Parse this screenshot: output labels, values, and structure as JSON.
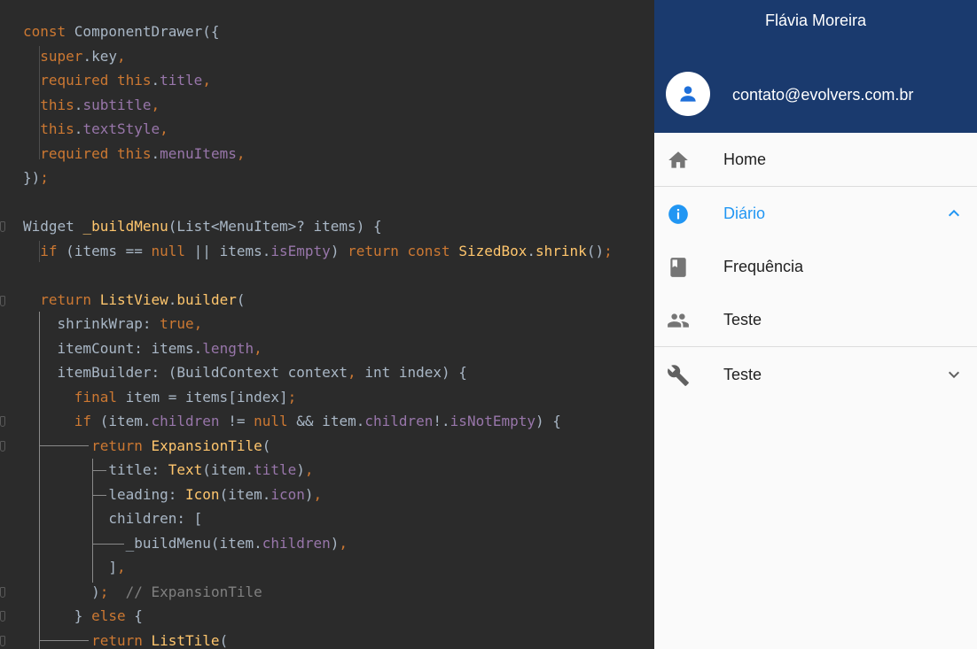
{
  "code": {
    "lines": [
      [
        {
          "t": "const ",
          "c": "kw"
        },
        {
          "t": "ComponentDrawer({",
          "c": ""
        }
      ],
      [
        {
          "t": "  super",
          "c": "kw"
        },
        {
          "t": ".key",
          "c": ""
        },
        {
          "t": ",",
          "c": "kw"
        }
      ],
      [
        {
          "t": "  required this",
          "c": "kw"
        },
        {
          "t": ".",
          "c": ""
        },
        {
          "t": "title",
          "c": "fld"
        },
        {
          "t": ",",
          "c": "kw"
        }
      ],
      [
        {
          "t": "  this",
          "c": "kw"
        },
        {
          "t": ".",
          "c": ""
        },
        {
          "t": "subtitle",
          "c": "fld"
        },
        {
          "t": ",",
          "c": "kw"
        }
      ],
      [
        {
          "t": "  this",
          "c": "kw"
        },
        {
          "t": ".",
          "c": ""
        },
        {
          "t": "textStyle",
          "c": "fld"
        },
        {
          "t": ",",
          "c": "kw"
        }
      ],
      [
        {
          "t": "  required this",
          "c": "kw"
        },
        {
          "t": ".",
          "c": ""
        },
        {
          "t": "menuItems",
          "c": "fld"
        },
        {
          "t": ",",
          "c": "kw"
        }
      ],
      [
        {
          "t": "})",
          "c": ""
        },
        {
          "t": ";",
          "c": "kw"
        }
      ],
      [],
      [
        {
          "t": "Widget ",
          "c": ""
        },
        {
          "t": "_buildMenu",
          "c": "fn"
        },
        {
          "t": "(List<MenuItem>? items) {",
          "c": ""
        }
      ],
      [
        {
          "t": "  if ",
          "c": "kw"
        },
        {
          "t": "(items == ",
          "c": ""
        },
        {
          "t": "null ",
          "c": "kw"
        },
        {
          "t": "|| items.",
          "c": ""
        },
        {
          "t": "isEmpty",
          "c": "fld"
        },
        {
          "t": ") ",
          "c": ""
        },
        {
          "t": "return const ",
          "c": "kw"
        },
        {
          "t": "SizedBox",
          "c": "fn"
        },
        {
          "t": ".",
          "c": ""
        },
        {
          "t": "shrink",
          "c": "fn"
        },
        {
          "t": "()",
          "c": ""
        },
        {
          "t": ";",
          "c": "kw"
        }
      ],
      [],
      [
        {
          "t": "  return ",
          "c": "kw"
        },
        {
          "t": "ListView",
          "c": "fn"
        },
        {
          "t": ".",
          "c": ""
        },
        {
          "t": "builder",
          "c": "fn"
        },
        {
          "t": "(",
          "c": ""
        }
      ],
      [
        {
          "t": "    shrinkWrap: ",
          "c": ""
        },
        {
          "t": "true",
          "c": "kw"
        },
        {
          "t": ",",
          "c": "kw"
        }
      ],
      [
        {
          "t": "    itemCount: items.",
          "c": ""
        },
        {
          "t": "length",
          "c": "fld"
        },
        {
          "t": ",",
          "c": "kw"
        }
      ],
      [
        {
          "t": "    itemBuilder: (BuildContext context",
          "c": ""
        },
        {
          "t": ", ",
          "c": "kw"
        },
        {
          "t": "int index) {",
          "c": ""
        }
      ],
      [
        {
          "t": "      final ",
          "c": "kw"
        },
        {
          "t": "item = items[index]",
          "c": ""
        },
        {
          "t": ";",
          "c": "kw"
        }
      ],
      [
        {
          "t": "      if ",
          "c": "kw"
        },
        {
          "t": "(item.",
          "c": ""
        },
        {
          "t": "children ",
          "c": "fld"
        },
        {
          "t": "!= ",
          "c": ""
        },
        {
          "t": "null ",
          "c": "kw"
        },
        {
          "t": "&& item.",
          "c": ""
        },
        {
          "t": "children",
          "c": "fld"
        },
        {
          "t": "!.",
          "c": ""
        },
        {
          "t": "isNotEmpty",
          "c": "fld"
        },
        {
          "t": ") {",
          "c": ""
        }
      ],
      [
        {
          "t": "        return ",
          "c": "kw"
        },
        {
          "t": "ExpansionTile",
          "c": "fn"
        },
        {
          "t": "(",
          "c": ""
        }
      ],
      [
        {
          "t": "          title: ",
          "c": ""
        },
        {
          "t": "Text",
          "c": "fn"
        },
        {
          "t": "(item.",
          "c": ""
        },
        {
          "t": "title",
          "c": "fld"
        },
        {
          "t": ")",
          "c": ""
        },
        {
          "t": ",",
          "c": "kw"
        }
      ],
      [
        {
          "t": "          leading: ",
          "c": ""
        },
        {
          "t": "Icon",
          "c": "fn"
        },
        {
          "t": "(item.",
          "c": ""
        },
        {
          "t": "icon",
          "c": "fld"
        },
        {
          "t": ")",
          "c": ""
        },
        {
          "t": ",",
          "c": "kw"
        }
      ],
      [
        {
          "t": "          children: [",
          "c": ""
        }
      ],
      [
        {
          "t": "            _buildMenu(item.",
          "c": ""
        },
        {
          "t": "children",
          "c": "fld"
        },
        {
          "t": ")",
          "c": ""
        },
        {
          "t": ",",
          "c": "kw"
        }
      ],
      [
        {
          "t": "          ]",
          "c": ""
        },
        {
          "t": ",",
          "c": "kw"
        }
      ],
      [
        {
          "t": "        )",
          "c": ""
        },
        {
          "t": ";  ",
          "c": "kw"
        },
        {
          "t": "// ExpansionTile",
          "c": "cm"
        }
      ],
      [
        {
          "t": "      } ",
          "c": ""
        },
        {
          "t": "else ",
          "c": "kw"
        },
        {
          "t": "{",
          "c": ""
        }
      ],
      [
        {
          "t": "        return ",
          "c": "kw"
        },
        {
          "t": "ListTile",
          "c": "fn"
        },
        {
          "t": "(",
          "c": ""
        }
      ]
    ]
  },
  "drawer": {
    "title": "Flávia Moreira",
    "email": "contato@evolvers.com.br",
    "accent": "#2196f3",
    "header_color": "#1a3a6e",
    "items": [
      {
        "label": "Home",
        "icon": "home-icon",
        "active": false,
        "chevron": ""
      },
      {
        "label": "Diário",
        "icon": "info-icon",
        "active": true,
        "chevron": "chevron-up-icon"
      },
      {
        "label": "Frequência",
        "icon": "book-icon",
        "active": false,
        "chevron": ""
      },
      {
        "label": "Teste",
        "icon": "people-icon",
        "active": false,
        "chevron": ""
      },
      {
        "label": "Teste",
        "icon": "wrench-icon",
        "active": false,
        "chevron": "chevron-down-icon"
      }
    ]
  }
}
